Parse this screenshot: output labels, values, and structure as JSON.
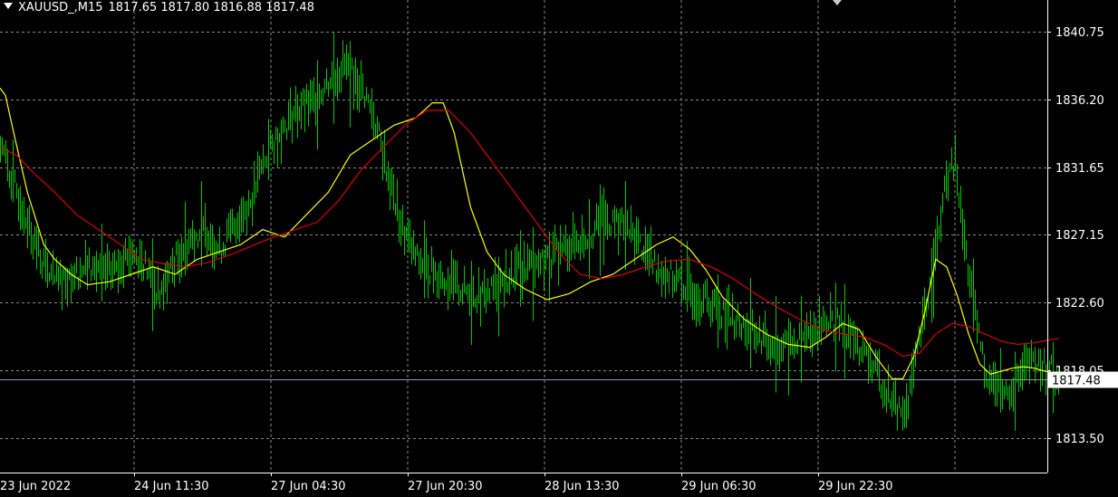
{
  "header": {
    "symbol": "XAUUSD_",
    "timeframe": "M15",
    "ohlc": [
      "1817.65",
      "1817.80",
      "1816.88",
      "1817.48"
    ]
  },
  "colors": {
    "background": "#000000",
    "grid": "#8a8a8a",
    "candles": "#00c800",
    "fast_ma": "#ffff00",
    "slow_ma": "#dd0000",
    "current_price_line": "#8c9aa8",
    "axis_text": "#ffffff"
  },
  "chart_data": {
    "type": "line",
    "title": "",
    "xlabel": "",
    "ylabel": "",
    "ylim": [
      1811.2,
      1842.9
    ],
    "grid": true,
    "x_tick_labels": [
      "23 Jun 2022",
      "24 Jun 11:30",
      "27 Jun 04:30",
      "27 Jun 20:30",
      "28 Jun 13:30",
      "29 Jun 06:30",
      "29 Jun 22:30"
    ],
    "y_ticks": [
      1840.75,
      1836.2,
      1831.65,
      1827.15,
      1822.6,
      1818.05,
      1813.5
    ],
    "y_tick_labels": [
      "1840.75",
      "1836.20",
      "1831.65",
      "1827.15",
      "1822.60",
      "1818.05",
      "1813.50"
    ],
    "current_price": 1817.48,
    "current_price_label": "1817.48",
    "price_keypoints": [
      [
        0,
        1833.5
      ],
      [
        0.2,
        1831.0
      ],
      [
        0.5,
        1828.0
      ],
      [
        0.8,
        1825.0
      ],
      [
        1.0,
        1824.0
      ],
      [
        1.3,
        1824.5
      ],
      [
        1.6,
        1825.0
      ],
      [
        2.0,
        1824.5
      ],
      [
        2.3,
        1826.0
      ],
      [
        2.6,
        1825.5
      ],
      [
        2.9,
        1823.0
      ],
      [
        3.2,
        1825.5
      ],
      [
        3.5,
        1827.0
      ],
      [
        3.8,
        1827.5
      ],
      [
        4.0,
        1826.0
      ],
      [
        4.3,
        1828.0
      ],
      [
        4.6,
        1829.5
      ],
      [
        4.8,
        1832.0
      ],
      [
        5.1,
        1834.0
      ],
      [
        5.4,
        1835.5
      ],
      [
        5.7,
        1836.0
      ],
      [
        6.0,
        1837.5
      ],
      [
        6.3,
        1838.5
      ],
      [
        6.6,
        1837.0
      ],
      [
        6.8,
        1835.5
      ],
      [
        7.1,
        1831.0
      ],
      [
        7.3,
        1828.0
      ],
      [
        7.6,
        1825.5
      ],
      [
        8.0,
        1824.5
      ],
      [
        8.4,
        1823.5
      ],
      [
        8.8,
        1823.0
      ],
      [
        9.2,
        1824.0
      ],
      [
        9.6,
        1825.0
      ],
      [
        10.0,
        1825.5
      ],
      [
        10.4,
        1826.5
      ],
      [
        10.7,
        1827.0
      ],
      [
        11.0,
        1828.0
      ],
      [
        11.3,
        1828.0
      ],
      [
        11.6,
        1827.0
      ],
      [
        12.0,
        1825.0
      ],
      [
        12.4,
        1824.0
      ],
      [
        12.8,
        1823.0
      ],
      [
        13.2,
        1822.0
      ],
      [
        13.6,
        1821.0
      ],
      [
        14.0,
        1820.0
      ],
      [
        14.4,
        1819.5
      ],
      [
        14.8,
        1820.5
      ],
      [
        15.1,
        1821.5
      ],
      [
        15.4,
        1821.0
      ],
      [
        15.7,
        1819.5
      ],
      [
        16.0,
        1818.0
      ],
      [
        16.3,
        1816.0
      ],
      [
        16.5,
        1815.0
      ],
      [
        16.7,
        1818.0
      ],
      [
        16.9,
        1822.0
      ],
      [
        17.1,
        1826.0
      ],
      [
        17.3,
        1831.0
      ],
      [
        17.45,
        1832.0
      ],
      [
        17.6,
        1827.0
      ],
      [
        17.8,
        1822.0
      ],
      [
        18.0,
        1818.0
      ],
      [
        18.2,
        1817.0
      ],
      [
        18.4,
        1816.5
      ],
      [
        18.6,
        1817.5
      ],
      [
        18.8,
        1818.5
      ],
      [
        19.0,
        1818.5
      ],
      [
        19.2,
        1818.0
      ],
      [
        19.35,
        1817.5
      ]
    ],
    "series": [
      {
        "kind": "fast_ma",
        "points": [
          [
            0.0,
            1837.0
          ],
          [
            0.1,
            1836.5
          ],
          [
            0.25,
            1834.0
          ],
          [
            0.5,
            1830.0
          ],
          [
            0.8,
            1826.5
          ],
          [
            1.0,
            1825.5
          ],
          [
            1.3,
            1824.5
          ],
          [
            1.6,
            1823.8
          ],
          [
            2.0,
            1824.0
          ],
          [
            2.4,
            1824.5
          ],
          [
            2.8,
            1825.0
          ],
          [
            3.2,
            1824.5
          ],
          [
            3.6,
            1825.5
          ],
          [
            4.0,
            1826.0
          ],
          [
            4.4,
            1826.5
          ],
          [
            4.8,
            1827.5
          ],
          [
            5.2,
            1827.0
          ],
          [
            5.6,
            1828.5
          ],
          [
            6.0,
            1830.0
          ],
          [
            6.4,
            1832.5
          ],
          [
            6.8,
            1833.5
          ],
          [
            7.2,
            1834.5
          ],
          [
            7.6,
            1835.0
          ],
          [
            7.9,
            1836.0
          ],
          [
            8.1,
            1836.0
          ],
          [
            8.3,
            1834.0
          ],
          [
            8.6,
            1829.0
          ],
          [
            8.9,
            1826.0
          ],
          [
            9.2,
            1824.5
          ],
          [
            9.6,
            1823.5
          ],
          [
            10.0,
            1822.8
          ],
          [
            10.4,
            1823.2
          ],
          [
            10.8,
            1824.0
          ],
          [
            11.2,
            1824.5
          ],
          [
            11.6,
            1825.5
          ],
          [
            12.0,
            1826.5
          ],
          [
            12.3,
            1827.0
          ],
          [
            12.6,
            1826.2
          ],
          [
            12.9,
            1824.8
          ],
          [
            13.2,
            1823.0
          ],
          [
            13.6,
            1821.5
          ],
          [
            14.0,
            1820.5
          ],
          [
            14.4,
            1819.8
          ],
          [
            14.8,
            1819.6
          ],
          [
            15.1,
            1820.3
          ],
          [
            15.4,
            1821.2
          ],
          [
            15.7,
            1820.8
          ],
          [
            16.0,
            1819.0
          ],
          [
            16.3,
            1817.5
          ],
          [
            16.5,
            1817.5
          ],
          [
            16.7,
            1819.0
          ],
          [
            16.9,
            1822.0
          ],
          [
            17.1,
            1825.5
          ],
          [
            17.3,
            1825.0
          ],
          [
            17.5,
            1823.0
          ],
          [
            17.7,
            1820.5
          ],
          [
            17.9,
            1818.5
          ],
          [
            18.1,
            1817.8
          ],
          [
            18.3,
            1818.0
          ],
          [
            18.5,
            1818.2
          ],
          [
            18.7,
            1818.3
          ],
          [
            18.9,
            1818.2
          ],
          [
            19.1,
            1818.0
          ],
          [
            19.35,
            1817.8
          ]
        ]
      },
      {
        "kind": "slow_ma",
        "points": [
          [
            0.0,
            1833.0
          ],
          [
            0.3,
            1832.5
          ],
          [
            0.7,
            1831.0
          ],
          [
            1.0,
            1830.0
          ],
          [
            1.4,
            1828.5
          ],
          [
            1.8,
            1827.5
          ],
          [
            2.2,
            1826.5
          ],
          [
            2.6,
            1825.5
          ],
          [
            3.0,
            1825.2
          ],
          [
            3.4,
            1825.0
          ],
          [
            3.8,
            1825.3
          ],
          [
            4.2,
            1825.8
          ],
          [
            4.6,
            1826.4
          ],
          [
            5.0,
            1827.0
          ],
          [
            5.4,
            1827.5
          ],
          [
            5.8,
            1828.0
          ],
          [
            6.2,
            1829.5
          ],
          [
            6.6,
            1831.5
          ],
          [
            7.0,
            1833.0
          ],
          [
            7.4,
            1834.5
          ],
          [
            7.8,
            1835.5
          ],
          [
            8.2,
            1835.5
          ],
          [
            8.6,
            1834.0
          ],
          [
            9.0,
            1832.0
          ],
          [
            9.4,
            1830.0
          ],
          [
            9.8,
            1828.0
          ],
          [
            10.2,
            1826.0
          ],
          [
            10.6,
            1824.5
          ],
          [
            11.0,
            1824.2
          ],
          [
            11.4,
            1824.5
          ],
          [
            11.8,
            1825.0
          ],
          [
            12.2,
            1825.4
          ],
          [
            12.6,
            1825.5
          ],
          [
            13.0,
            1825.0
          ],
          [
            13.4,
            1824.2
          ],
          [
            13.8,
            1823.2
          ],
          [
            14.2,
            1822.3
          ],
          [
            14.6,
            1821.5
          ],
          [
            15.0,
            1820.8
          ],
          [
            15.4,
            1820.5
          ],
          [
            15.8,
            1820.3
          ],
          [
            16.2,
            1819.7
          ],
          [
            16.5,
            1819.0
          ],
          [
            16.8,
            1819.2
          ],
          [
            17.1,
            1820.5
          ],
          [
            17.4,
            1821.2
          ],
          [
            17.7,
            1821.0
          ],
          [
            18.0,
            1820.5
          ],
          [
            18.3,
            1820.0
          ],
          [
            18.6,
            1819.8
          ],
          [
            18.9,
            1819.9
          ],
          [
            19.2,
            1820.1
          ],
          [
            19.35,
            1820.2
          ]
        ]
      }
    ]
  }
}
